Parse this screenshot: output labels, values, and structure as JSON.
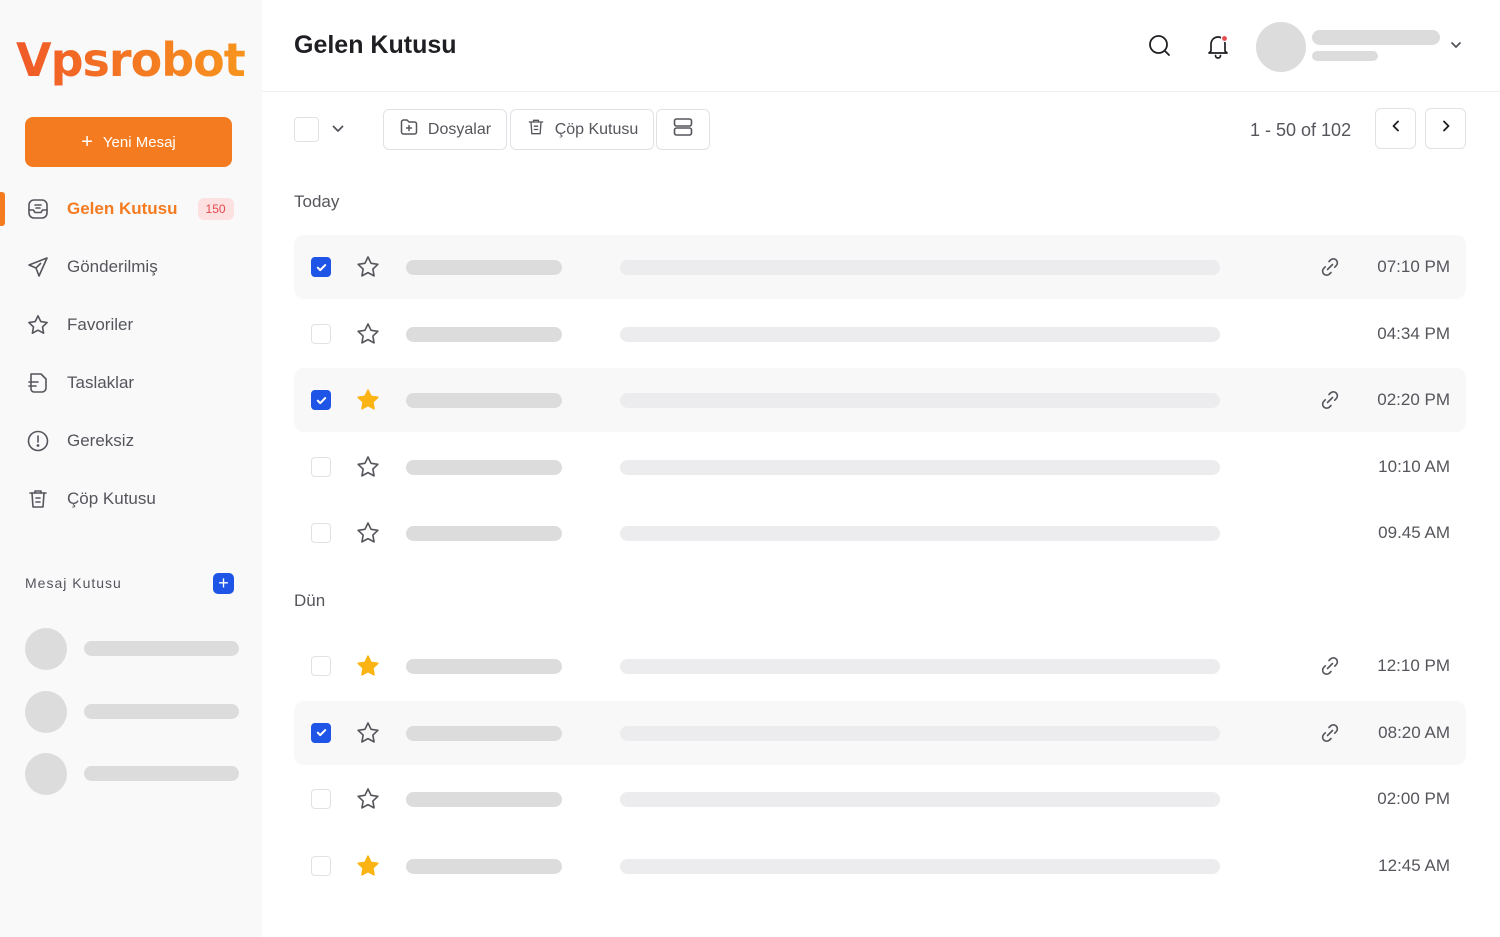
{
  "brand": {
    "logo_text": "Vpsrobot",
    "accent": "#f47b20",
    "blue": "#1e55e6"
  },
  "sidebar": {
    "new_message_label": "Yeni Mesaj",
    "items": [
      {
        "label": "Gelen Kutusu",
        "icon": "inbox-icon",
        "active": true,
        "badge": "150"
      },
      {
        "label": "Gönderilmiş",
        "icon": "send-icon"
      },
      {
        "label": "Favoriler",
        "icon": "star-icon"
      },
      {
        "label": "Taslaklar",
        "icon": "draft-icon"
      },
      {
        "label": "Gereksiz",
        "icon": "alert-circle-icon"
      },
      {
        "label": "Çöp Kutusu",
        "icon": "trash-icon"
      }
    ],
    "mailbox_title": "Mesaj Kutusu",
    "mailbox_add_label": "+"
  },
  "header": {
    "title": "Gelen Kutusu",
    "icons": [
      "search-icon",
      "bell-icon",
      "chevron-down-icon"
    ]
  },
  "toolbar": {
    "files_label": "Dosyalar",
    "trash_label": "Çöp Kutusu",
    "pagination": "1 - 50 of 102"
  },
  "groups": [
    {
      "label": "Today",
      "messages": [
        {
          "time": "07:10 PM",
          "checked": true,
          "starred": false,
          "attachment": true
        },
        {
          "time": "04:34 PM",
          "checked": false,
          "starred": false,
          "attachment": false
        },
        {
          "time": "02:20 PM",
          "checked": true,
          "starred": true,
          "attachment": true
        },
        {
          "time": "10:10 AM",
          "checked": false,
          "starred": false,
          "attachment": false
        },
        {
          "time": "09.45 AM",
          "checked": false,
          "starred": false,
          "attachment": false
        }
      ]
    },
    {
      "label": "Dün",
      "messages": [
        {
          "time": "12:10 PM",
          "checked": false,
          "starred": true,
          "attachment": true
        },
        {
          "time": "08:20 AM",
          "checked": true,
          "starred": false,
          "attachment": true
        },
        {
          "time": "02:00 PM",
          "checked": false,
          "starred": false,
          "attachment": false
        },
        {
          "time": "12:45 AM",
          "checked": false,
          "starred": true,
          "attachment": false
        }
      ]
    }
  ]
}
